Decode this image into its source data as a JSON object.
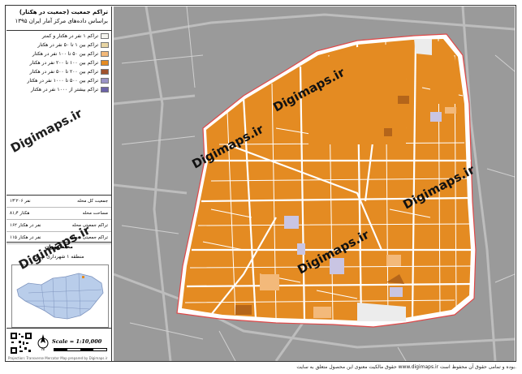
{
  "title": {
    "line1": "تراکم جمعیت (جمعیت در هکتار)",
    "line2": "براساس داده‌های مرکز آمار ایران ۱۳۹۵"
  },
  "legend": [
    {
      "label": "تراکم ۱ نفر در هکتار و کمتر",
      "color": "#f5f5f0"
    },
    {
      "label": "تراکم بین ۱ تا ۵۰ نفر در هکتار",
      "color": "#e8d5a3"
    },
    {
      "label": "تراکم بین ۵۰ تا ۱۰۰ نفر در هکتار",
      "color": "#f3b97a"
    },
    {
      "label": "تراکم بین ۱۰۰ تا ۲۰۰ نفر در هکتار",
      "color": "#e48b22"
    },
    {
      "label": "تراکم بین ۲۰۰ تا ۵۰۰ نفر در هکتار",
      "color": "#a0522d"
    },
    {
      "label": "تراکم بین ۵۰۰ تا ۱۰۰۰ نفر در هکتار",
      "color": "#9a93c6"
    },
    {
      "label": "تراکم بیشتر از ۱۰۰۰ نفر در هکتار",
      "color": "#6c63a8"
    }
  ],
  "stats": [
    {
      "label": "جمعیت کل محله",
      "value": "۱۳٬۲۰۶ نفر"
    },
    {
      "label": "مساحت محله",
      "value": "۸۱٫۴ هکتار"
    },
    {
      "label": "تراکم جمعیتی محله",
      "value": "۱۶۲ نفر در هکتار"
    },
    {
      "label": "تراکم جمعیتی منطقه",
      "value": "۱۱۵ نفر در هکتار"
    },
    {
      "label": "تراکم جمعیتی شهر تهران",
      "value": "۱۰۷ نفر در هکتار"
    }
  ],
  "locator": {
    "line1": "محله مهران",
    "line2": "منطقه ۱ شهرداری تهران"
  },
  "scale": "Scale = 1:10,000",
  "credit": "Projection: Transverse Mercator   Map prepared by Digimaps.ir",
  "footer": "حقوق مالکیت معنوی این محصول متعلق به سایت www.digimaps.ir بوده و تمامی حقوق آن محفوظ است.",
  "watermark": "Digimaps.ir",
  "colors": {
    "block": "#e48b22",
    "block_dark": "#b4651a",
    "block_light": "#f3b97a",
    "block_lavender": "#c9c5e3",
    "boundary": "#e04848",
    "surroundings": "#9a9a9a"
  }
}
